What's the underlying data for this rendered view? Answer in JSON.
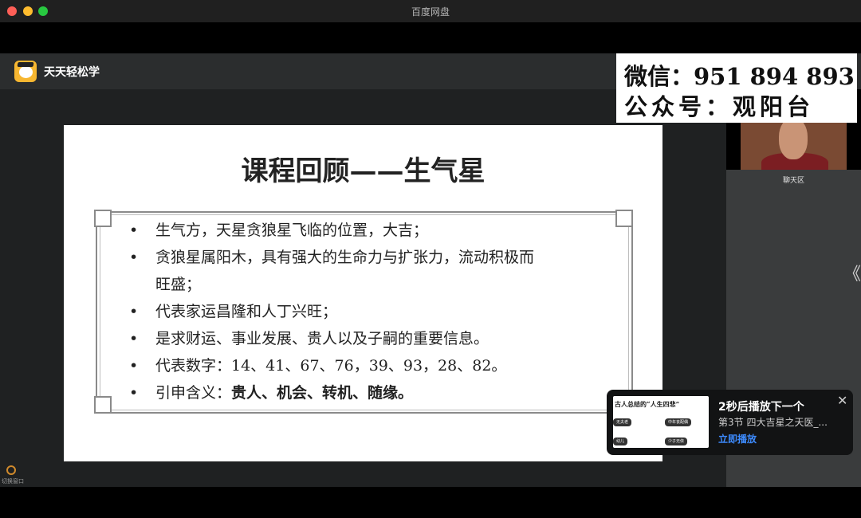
{
  "window": {
    "title": "百度网盘"
  },
  "app": {
    "name": "天天轻松学"
  },
  "watermark": {
    "line1": "微信：951 894 893",
    "line2": "公众号：观阳台"
  },
  "slide": {
    "title": "课程回顾——生气星",
    "bullet_symbol": "•",
    "bullets": [
      "生气方，天星贪狼星飞临的位置，大吉；",
      "贪狼星属阳木，具有强大的生命力与扩张力，流动积极而",
      "旺盛；",
      "代表家运昌隆和人丁兴旺；",
      "是求财运、事业发展、贵人以及子嗣的重要信息。",
      "代表数字：14、41、67、76，39、93，28、82。"
    ],
    "last_bullet": {
      "prefix": "引申含义：",
      "bold": "贵人、机会、转机、随缘。"
    }
  },
  "sidebar": {
    "chat_title": "聊天区",
    "collapse_glyph": "《"
  },
  "left_tool": {
    "label": "切换窗口"
  },
  "next_up": {
    "heading": "2秒后播放下一个",
    "subtitle": "第3节 四大吉星之天医_...",
    "play_now": "立即播放",
    "close_glyph": "✕",
    "thumb": {
      "title": "古人总结的“人生四悲”",
      "pills": [
        "无夫老",
        "中年丧配偶",
        "幼儿",
        "少子无依"
      ]
    }
  },
  "colors": {
    "accent_blue": "#3d8bff",
    "logo_yellow": "#f7b731"
  }
}
